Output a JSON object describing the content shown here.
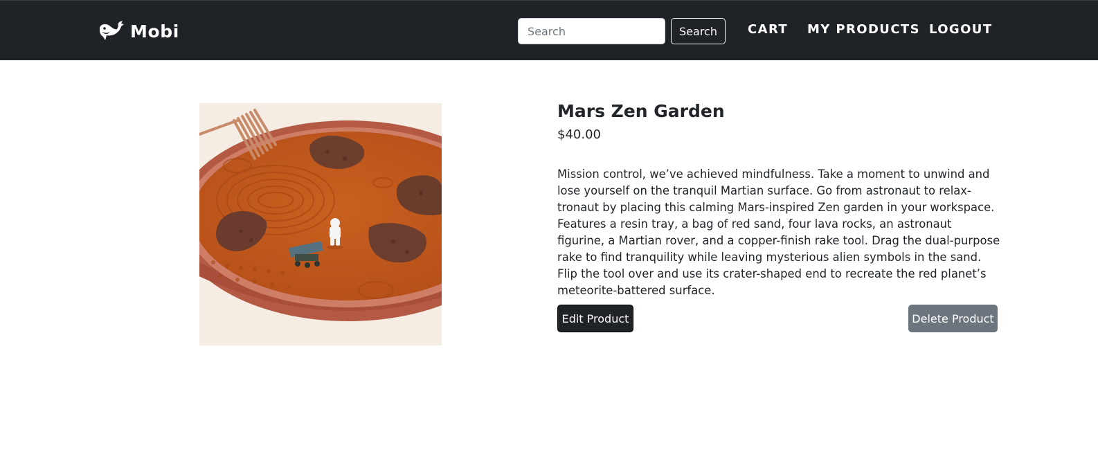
{
  "navbar": {
    "brand_icon": "whale-icon",
    "brand_name": "Mobi",
    "search": {
      "placeholder": "Search",
      "value": "",
      "button_label": "Search"
    },
    "links": {
      "cart": "CART",
      "my_products": "MY PRODUCTS",
      "logout": "LOGOUT"
    }
  },
  "product": {
    "image_icon": "mars-zen-garden-photo",
    "title": "Mars Zen Garden",
    "price": "$40.00",
    "description": "Mission control, we’ve achieved mindfulness. Take a moment to unwind and lose yourself on the tranquil Martian surface. Go from astronaut to relax-tronaut by placing this calming Mars-inspired Zen garden in your workspace. Features a resin tray, a bag of red sand, four lava rocks, an astronaut figurine, a Martian rover, and a copper-finish rake tool. Drag the dual-purpose rake to find tranquility while leaving mysterious alien symbols in the sand. Flip the tool over and use its crater-shaped end to recreate the red planet’s meteorite-battered surface.",
    "edit_label": "Edit Product",
    "delete_label": "Delete Product"
  },
  "colors": {
    "navbar_bg": "#1f2226",
    "edit_button": "#1f2226",
    "delete_button": "#6c757d",
    "sand": "#c2571f"
  }
}
